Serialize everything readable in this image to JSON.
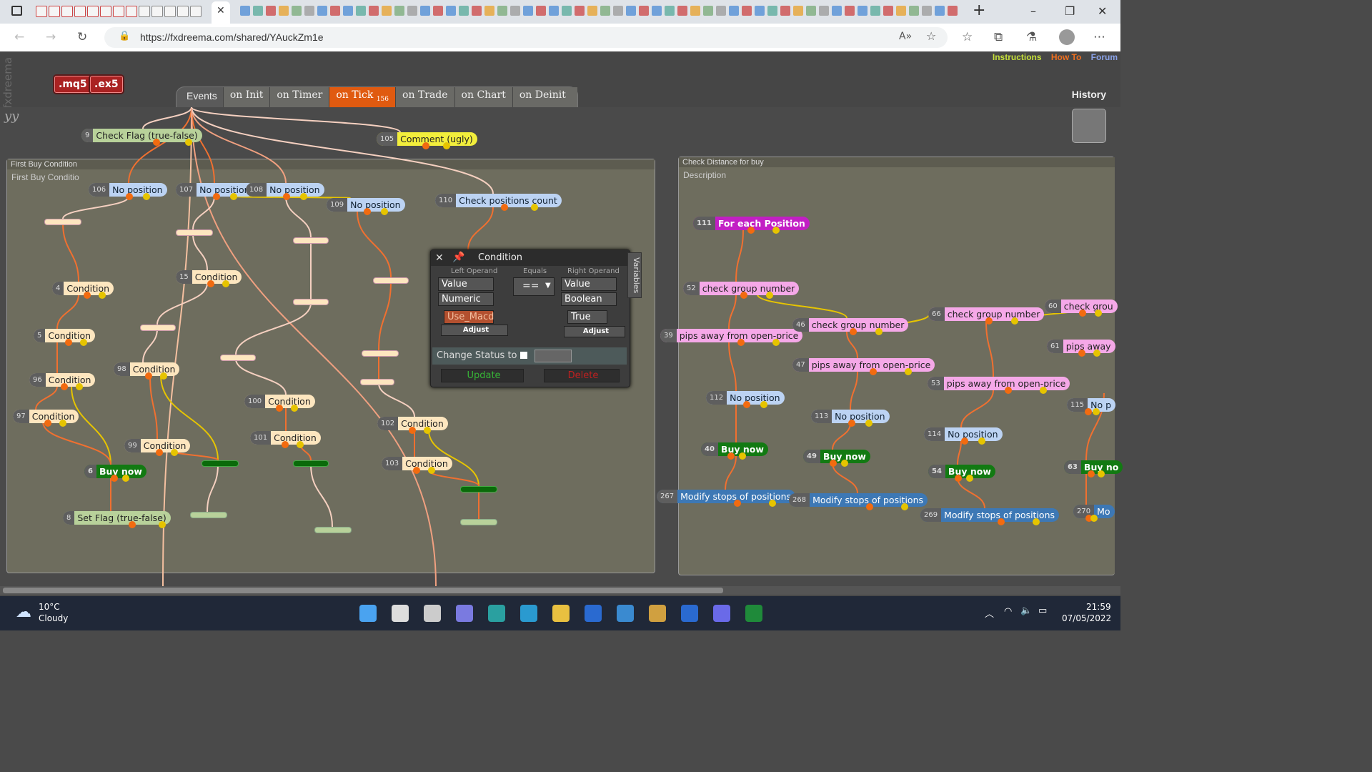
{
  "browser": {
    "url": "https://fxdreema.com/shared/YAuckZm1e",
    "new_tab": "+",
    "window_controls": [
      "–",
      "❐",
      "✕"
    ]
  },
  "app": {
    "brand_vertical": "fxdreema",
    "brand_short": "yy",
    "top_links": [
      "Instructions",
      "How To",
      "Forum"
    ],
    "top_link_colors": [
      "#c6e03a",
      "#f07020",
      "#8aa2e8"
    ],
    "file_buttons": [
      ".mq5",
      ".ex5"
    ],
    "events_label": "Events",
    "event_tabs": [
      "on Init",
      "on Timer",
      "on Tick",
      "on Trade",
      "on Chart",
      "on Deinit"
    ],
    "active_tab_badge": "156",
    "history": "History"
  },
  "groups": {
    "left": {
      "title": "First Buy Condition",
      "description": "First Buy Conditio"
    },
    "right": {
      "title": "Check Distance for buy",
      "description": "Description"
    }
  },
  "nodes": [
    {
      "id": "9",
      "label": "Check Flag (true-false)",
      "kind": "flag"
    },
    {
      "id": "105",
      "label": "Comment (ugly)",
      "kind": "yellow"
    },
    {
      "id": "106",
      "label": "No position",
      "kind": "nopos"
    },
    {
      "id": "107",
      "label": "No position",
      "kind": "nopos"
    },
    {
      "id": "108",
      "label": "No position",
      "kind": "nopos"
    },
    {
      "id": "109",
      "label": "No position",
      "kind": "nopos"
    },
    {
      "id": "110",
      "label": "Check positions count",
      "kind": "nopos"
    },
    {
      "id": "4",
      "label": "Condition",
      "kind": "cond"
    },
    {
      "id": "15",
      "label": "Condition",
      "kind": "cond"
    },
    {
      "id": "5",
      "label": "Condition",
      "kind": "cond"
    },
    {
      "id": "96",
      "label": "Condition",
      "kind": "cond"
    },
    {
      "id": "98",
      "label": "Condition",
      "kind": "cond"
    },
    {
      "id": "97",
      "label": "Condition",
      "kind": "cond"
    },
    {
      "id": "100",
      "label": "Condition",
      "kind": "cond"
    },
    {
      "id": "101",
      "label": "Condition",
      "kind": "cond"
    },
    {
      "id": "102",
      "label": "Condition",
      "kind": "cond"
    },
    {
      "id": "103",
      "label": "Condition",
      "kind": "cond"
    },
    {
      "id": "99",
      "label": "Condition",
      "kind": "cond"
    },
    {
      "id": "6",
      "label": "Buy now",
      "kind": "buy"
    },
    {
      "id": "8",
      "label": "Set Flag (true-false)",
      "kind": "flag"
    },
    {
      "id": "111",
      "label": "For each Position",
      "kind": "magenta"
    },
    {
      "id": "52",
      "label": "check group number",
      "kind": "pink"
    },
    {
      "id": "39",
      "label": "pips away from open-price",
      "kind": "pink"
    },
    {
      "id": "46",
      "label": "check group number",
      "kind": "pink"
    },
    {
      "id": "66",
      "label": "check group number",
      "kind": "pink"
    },
    {
      "id": "60",
      "label": "check grou",
      "kind": "pink"
    },
    {
      "id": "47",
      "label": "pips away from open-price",
      "kind": "pink"
    },
    {
      "id": "61",
      "label": "pips away",
      "kind": "pink"
    },
    {
      "id": "53",
      "label": "pips away from open-price",
      "kind": "pink"
    },
    {
      "id": "112",
      "label": "No position",
      "kind": "nopos"
    },
    {
      "id": "113",
      "label": "No position",
      "kind": "nopos"
    },
    {
      "id": "114",
      "label": "No position",
      "kind": "nopos"
    },
    {
      "id": "115",
      "label": "No p",
      "kind": "nopos"
    },
    {
      "id": "40",
      "label": "Buy now",
      "kind": "buy"
    },
    {
      "id": "49",
      "label": "Buy now",
      "kind": "buy"
    },
    {
      "id": "54",
      "label": "Buy now",
      "kind": "buy"
    },
    {
      "id": "63",
      "label": "Buy no",
      "kind": "buy"
    },
    {
      "id": "267",
      "label": "Modify stops of positions",
      "kind": "mod"
    },
    {
      "id": "268",
      "label": "Modify stops of positions",
      "kind": "mod"
    },
    {
      "id": "269",
      "label": "Modify stops of positions",
      "kind": "mod"
    },
    {
      "id": "270",
      "label": "Mo",
      "kind": "mod"
    }
  ],
  "dialog": {
    "title": "Condition",
    "left_operand_label": "Left Operand",
    "equals_label": "Equals",
    "right_operand_label": "Right Operand",
    "left_type": "Value",
    "left_subtype": "Numeric",
    "left_value": "Use_Macd",
    "operator": "==",
    "right_type": "Value",
    "right_subtype": "Boolean",
    "right_value": "True",
    "adjust": "Adjust",
    "change_status": "Change Status to",
    "update": "Update",
    "delete": "Delete",
    "variables": "Variables"
  },
  "taskbar": {
    "temp": "10°C",
    "weather": "Cloudy",
    "time": "21:59",
    "date": "07/05/2022"
  }
}
